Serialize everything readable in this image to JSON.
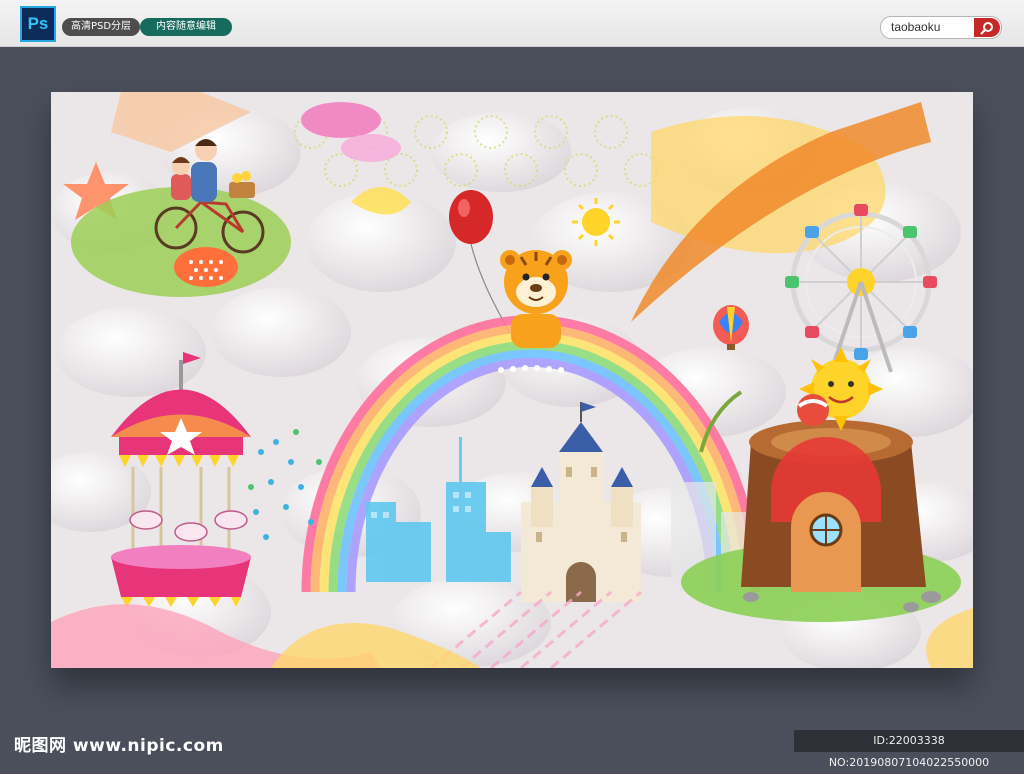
{
  "header": {
    "ps_label": "Ps",
    "tag_layers": "高清PSD分层",
    "tag_editable": "内容随意编辑",
    "search_value": "taobaoku"
  },
  "footer": {
    "brand": "昵图网 www.nipic.com",
    "id_text": "ID:22003338 NO:20190807104022550000"
  },
  "artwork": {
    "subject": "children's cartoon amusement park wallpaper",
    "elements": [
      "star",
      "bicycle-couple",
      "balloon",
      "tiger",
      "sun",
      "ferris-wheel",
      "hot-air-balloon",
      "carousel",
      "rainbow",
      "city-buildings",
      "castle",
      "tree-stump-house",
      "smiling-sun"
    ],
    "colors": {
      "rainbow": [
        "#ff6f9c",
        "#ffb36b",
        "#ffe46b",
        "#8fdd7b",
        "#6fc3ff",
        "#a89cff"
      ],
      "carousel": "#e8357a",
      "tiger": "#f7a21a",
      "stump": "#8a4b22",
      "balloon": "#d62828"
    }
  }
}
